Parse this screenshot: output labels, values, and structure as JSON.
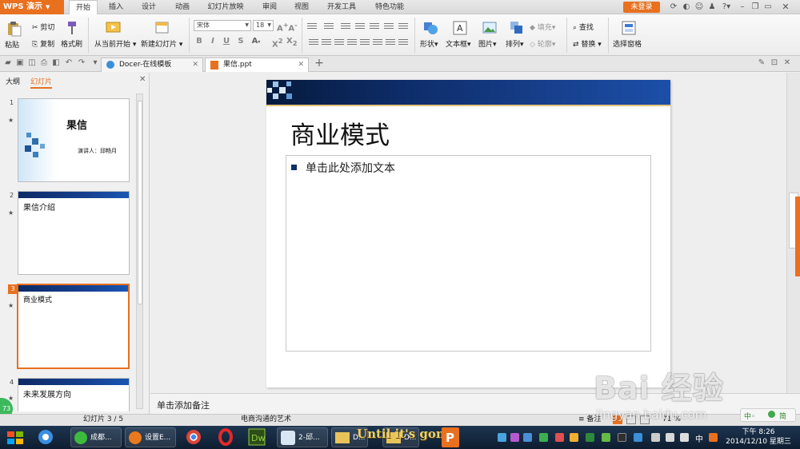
{
  "app": {
    "menu_label": "WPS 演示",
    "login_label": "未登录"
  },
  "menu_tabs": [
    "开始",
    "插入",
    "设计",
    "动画",
    "幻灯片放映",
    "审阅",
    "视图",
    "开发工具",
    "特色功能"
  ],
  "ribbon": {
    "paste": "粘贴",
    "cut": "剪切",
    "copy": "复制",
    "format_painter": "格式刷",
    "from_current": "从当前开始",
    "new_slide": "新建幻灯片",
    "font_name": "宋体",
    "font_size": "18",
    "shape": "形状",
    "textbox": "文本框",
    "picture": "图片",
    "arrange": "排列",
    "fill": "填充",
    "outline": "轮廓",
    "find": "查找",
    "replace": "替换",
    "selection_pane": "选择窗格"
  },
  "doc_tabs": [
    {
      "label": "Docer-在线模板"
    },
    {
      "label": "果信.ppt"
    }
  ],
  "panel_tabs": [
    "大纲",
    "幻灯片"
  ],
  "slides": [
    {
      "num": "1",
      "title": "果信",
      "subtitle": "演讲人：邱畅月"
    },
    {
      "num": "2",
      "title": "果信介绍"
    },
    {
      "num": "3",
      "title": "商业模式"
    },
    {
      "num": "4",
      "title": "未来发展方向"
    }
  ],
  "current_slide": {
    "title": "商业模式",
    "placeholder": "单击此处添加文本"
  },
  "notes": {
    "placeholder": "单击添加备注"
  },
  "status": {
    "slide_counter": "幻灯片 3 / 5",
    "theme": "电商沟通的艺术",
    "notes_btn": "备注",
    "zoom": "71 %"
  },
  "taskbar": {
    "items": [
      "成都...",
      "设置E...",
      "2-邱...",
      "D...",
      "D..."
    ],
    "overlay": "Until it's gone",
    "ime": "中",
    "clock_time": "下午 8:26",
    "clock_date": "2014/12/10 星期三",
    "badge": "73"
  },
  "watermark": {
    "main": "Bai 经验",
    "url": "jingyan.baidu.com"
  },
  "colors": {
    "accent": "#e8701f",
    "slide_band": "#0e2d6a"
  }
}
